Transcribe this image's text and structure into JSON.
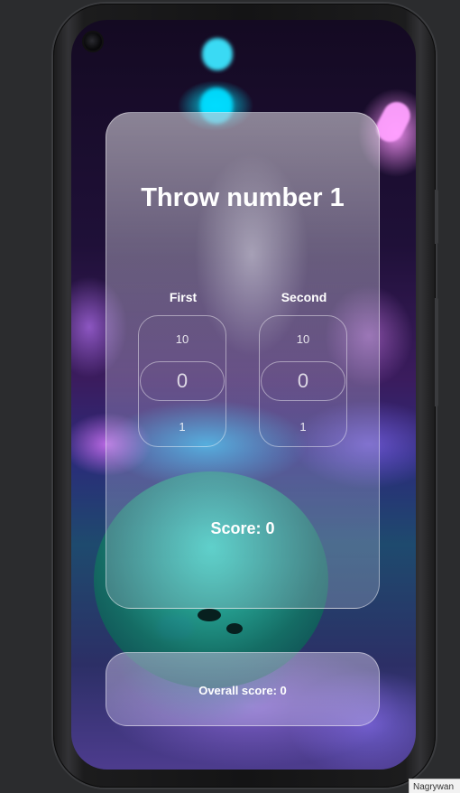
{
  "app": {
    "title": "Throw number 1",
    "first_label": "First",
    "second_label": "Second",
    "first_picker": {
      "above": "10",
      "selected": "0",
      "below": "1"
    },
    "second_picker": {
      "above": "10",
      "selected": "0",
      "below": "1"
    },
    "score_text": "Score: 0",
    "overall_text": "Overall score: 0"
  },
  "host": {
    "tooltip_text": "Nagrywan"
  },
  "icons": {
    "camera": "front-camera-icon"
  },
  "colors": {
    "text": "#ffffff",
    "desktop_bg": "#2b2c2e",
    "accent_cyan": "#00e6ff",
    "accent_pink": "#ff96ff"
  }
}
